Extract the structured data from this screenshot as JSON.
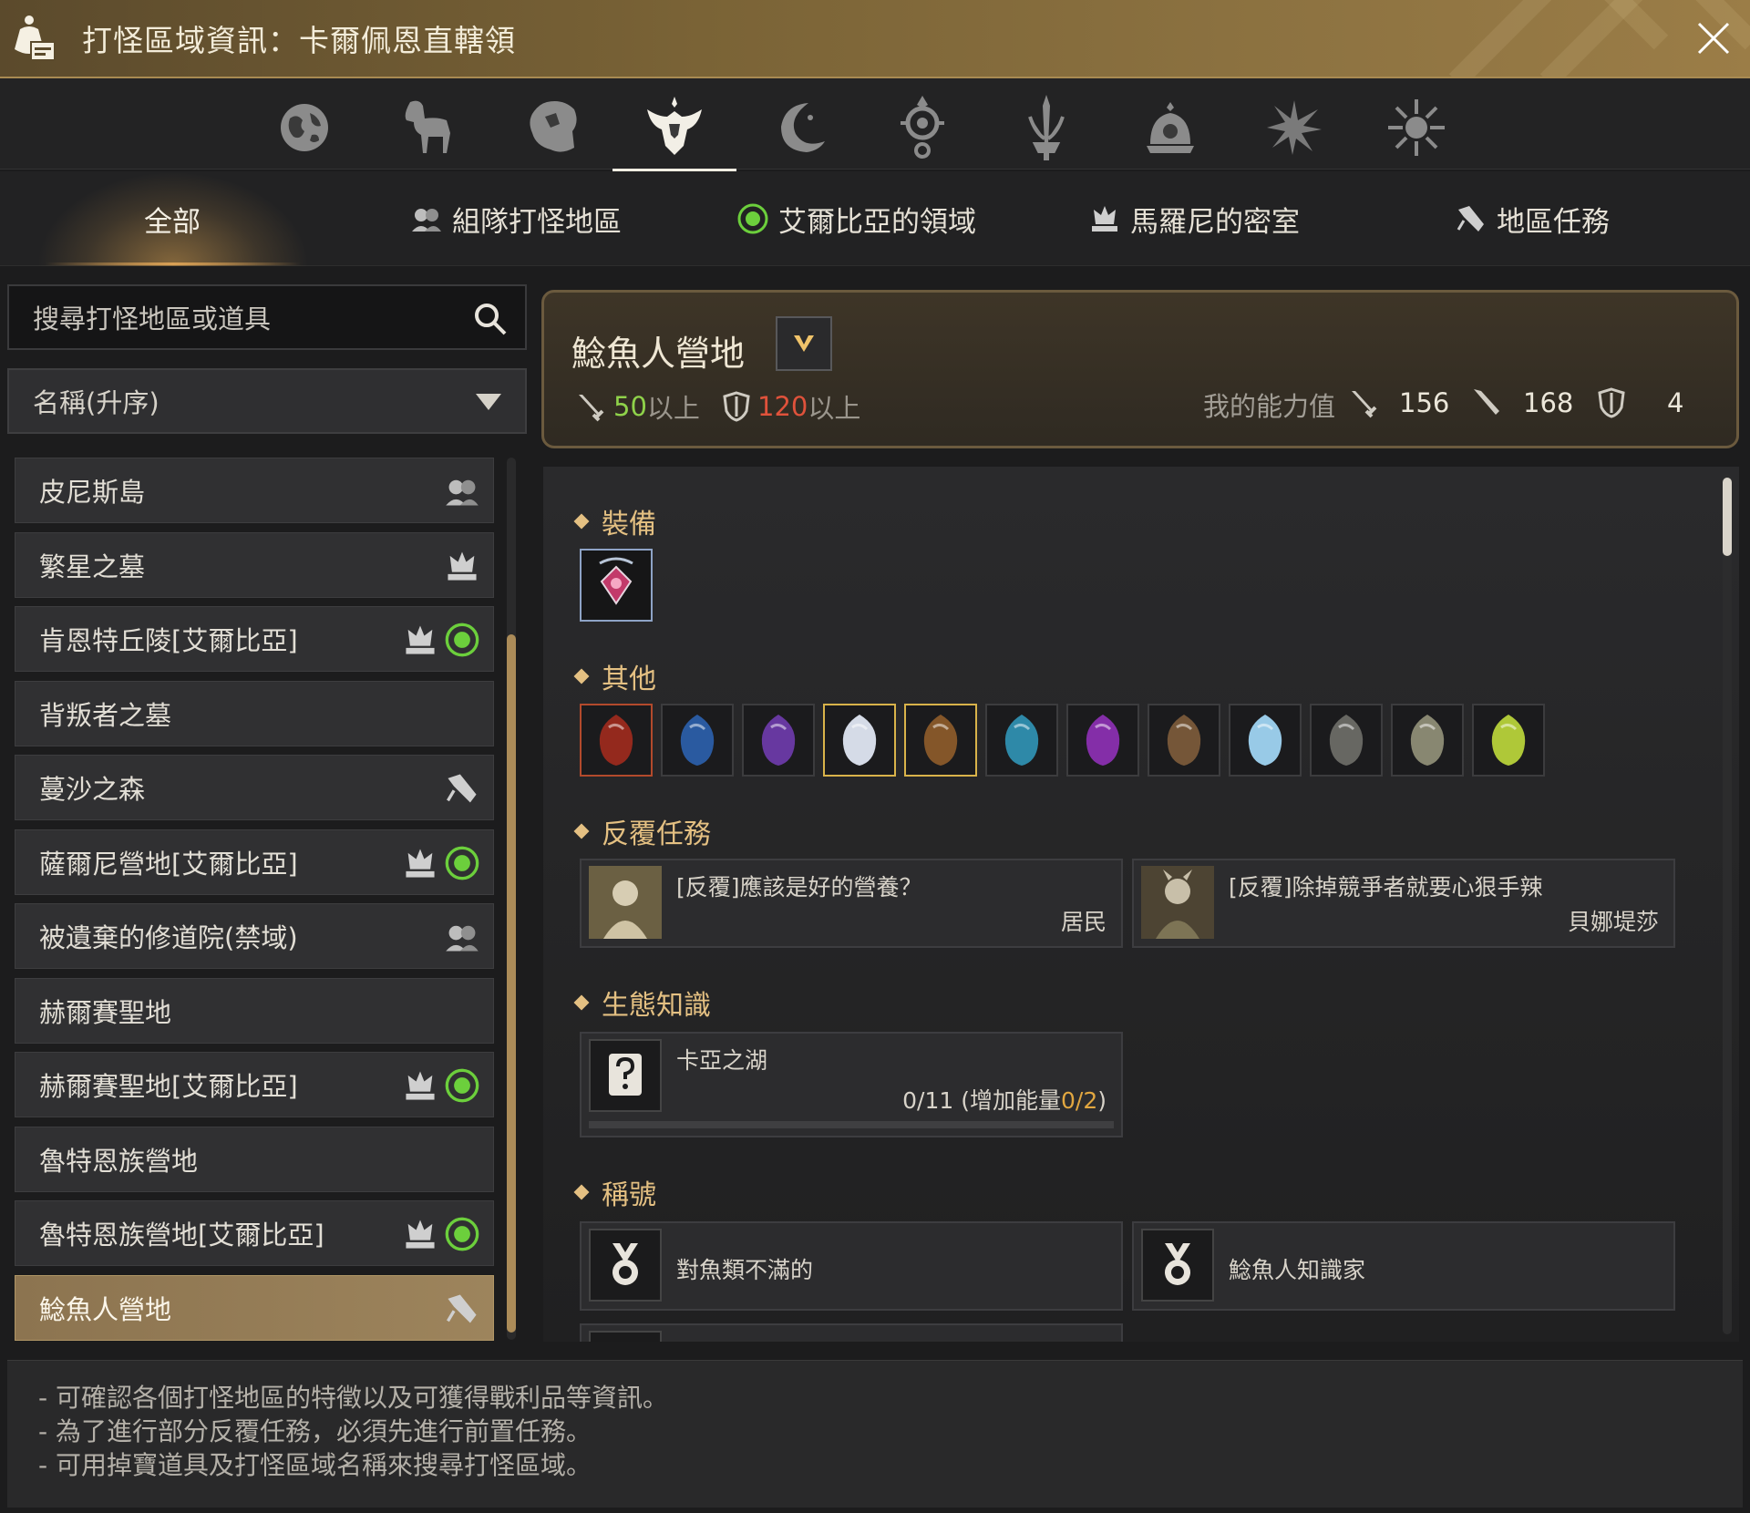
{
  "window": {
    "title": "打怪區域資訊：卡爾佩恩直轄領"
  },
  "category_icons": [
    {
      "name": "globe-icon"
    },
    {
      "name": "horse-icon"
    },
    {
      "name": "lion-icon"
    },
    {
      "name": "winged-crest-icon",
      "active": true
    },
    {
      "name": "crescent-moon-icon"
    },
    {
      "name": "eye-pendant-icon"
    },
    {
      "name": "flame-sword-icon"
    },
    {
      "name": "dome-crest-icon"
    },
    {
      "name": "star-burst-icon"
    },
    {
      "name": "sun-burst-icon"
    }
  ],
  "filter_tabs": [
    {
      "label": "全部",
      "icon": "",
      "active": true
    },
    {
      "label": "組隊打怪地區",
      "icon": "party-icon"
    },
    {
      "label": "艾爾比亞的領域",
      "icon": "elvia-icon"
    },
    {
      "label": "馬羅尼的密室",
      "icon": "crown-icon"
    },
    {
      "label": "地區任務",
      "icon": "quest-scroll-icon"
    }
  ],
  "search": {
    "placeholder": "搜尋打怪地區或道具"
  },
  "sort": {
    "selected": "名稱(升序)"
  },
  "zone_list": [
    {
      "label": "皮尼斯島",
      "icons": [
        "party"
      ]
    },
    {
      "label": "繁星之墓",
      "icons": [
        "crown"
      ]
    },
    {
      "label": "肯恩特丘陵[艾爾比亞]",
      "icons": [
        "crown",
        "elvia"
      ]
    },
    {
      "label": "背叛者之墓",
      "icons": []
    },
    {
      "label": "蔓沙之森",
      "icons": [
        "quest"
      ]
    },
    {
      "label": "薩爾尼營地[艾爾比亞]",
      "icons": [
        "crown",
        "elvia"
      ]
    },
    {
      "label": "被遺棄的修道院(禁域)",
      "icons": [
        "party"
      ]
    },
    {
      "label": "赫爾賽聖地",
      "icons": []
    },
    {
      "label": "赫爾賽聖地[艾爾比亞]",
      "icons": [
        "crown",
        "elvia"
      ]
    },
    {
      "label": "魯特恩族營地",
      "icons": []
    },
    {
      "label": "魯特恩族營地[艾爾比亞]",
      "icons": [
        "crown",
        "elvia"
      ]
    },
    {
      "label": "鯰魚人營地",
      "icons": [
        "quest"
      ],
      "selected": true
    }
  ],
  "zone": {
    "name": "鯰魚人營地",
    "ap_req_value": "50",
    "ap_req_suffix": "以上",
    "dp_req_value": "120",
    "dp_req_suffix": "以上",
    "my_stats_label": "我的能力值",
    "my_ap": "156",
    "my_aap": "168",
    "my_dp": "4"
  },
  "sections": {
    "equipment": "裝備",
    "others": "其他",
    "repeat_quests": "反覆任務",
    "knowledge": "生態知識",
    "titles": "稱號"
  },
  "equipment_items": [
    {
      "name": "ruby-necklace-icon",
      "color": "#c23a6a"
    }
  ],
  "other_items": [
    {
      "name": "red-card-icon",
      "color": "#9b2a1e"
    },
    {
      "name": "blue-stone-icon",
      "color": "#2b5ea8"
    },
    {
      "name": "purple-stone-icon",
      "color": "#6b3aa8"
    },
    {
      "name": "white-tile-icon",
      "color": "#dfe6f2"
    },
    {
      "name": "treasure-chest-icon",
      "color": "#8a5a2a"
    },
    {
      "name": "blue-pouch-icon",
      "color": "#2f8fb0"
    },
    {
      "name": "purple-pouch-icon",
      "color": "#8a2fb0"
    },
    {
      "name": "silver-chest-icon",
      "color": "#7a5a3a"
    },
    {
      "name": "crystal-wand-icon",
      "color": "#9fd4f2"
    },
    {
      "name": "ore-fragment-icon",
      "color": "#6c6c66"
    },
    {
      "name": "fish-scale-icon",
      "color": "#8e8d76"
    },
    {
      "name": "green-bulb-icon",
      "color": "#b7d23a"
    }
  ],
  "repeat_quests": [
    {
      "title": "[反覆]應該是好的營養？",
      "npc": "居民"
    },
    {
      "title": "[反覆]除掉競爭者就要心狠手辣",
      "npc": "貝娜堤莎"
    }
  ],
  "knowledge": {
    "title": "卡亞之湖",
    "progress_main": "0/11 (增加能量",
    "progress_energy": "0/2",
    "progress_close": ")",
    "progress_fraction": 0
  },
  "titles": [
    {
      "label": "對魚類不滿的"
    },
    {
      "label": "鯰魚人知識家"
    }
  ],
  "footer_notes": [
    "- 可確認各個打怪地區的特徵以及可獲得戰利品等資訊。",
    "- 為了進行部分反覆任務，必須先進行前置任務。",
    "- 可用掉寶道具及打怪區域名稱來搜尋打怪區域。"
  ],
  "colors": {
    "accent_gold": "#e4c082",
    "green_req": "#8fd24a",
    "red_req": "#e0523b",
    "selected_row": "#9d845c"
  }
}
